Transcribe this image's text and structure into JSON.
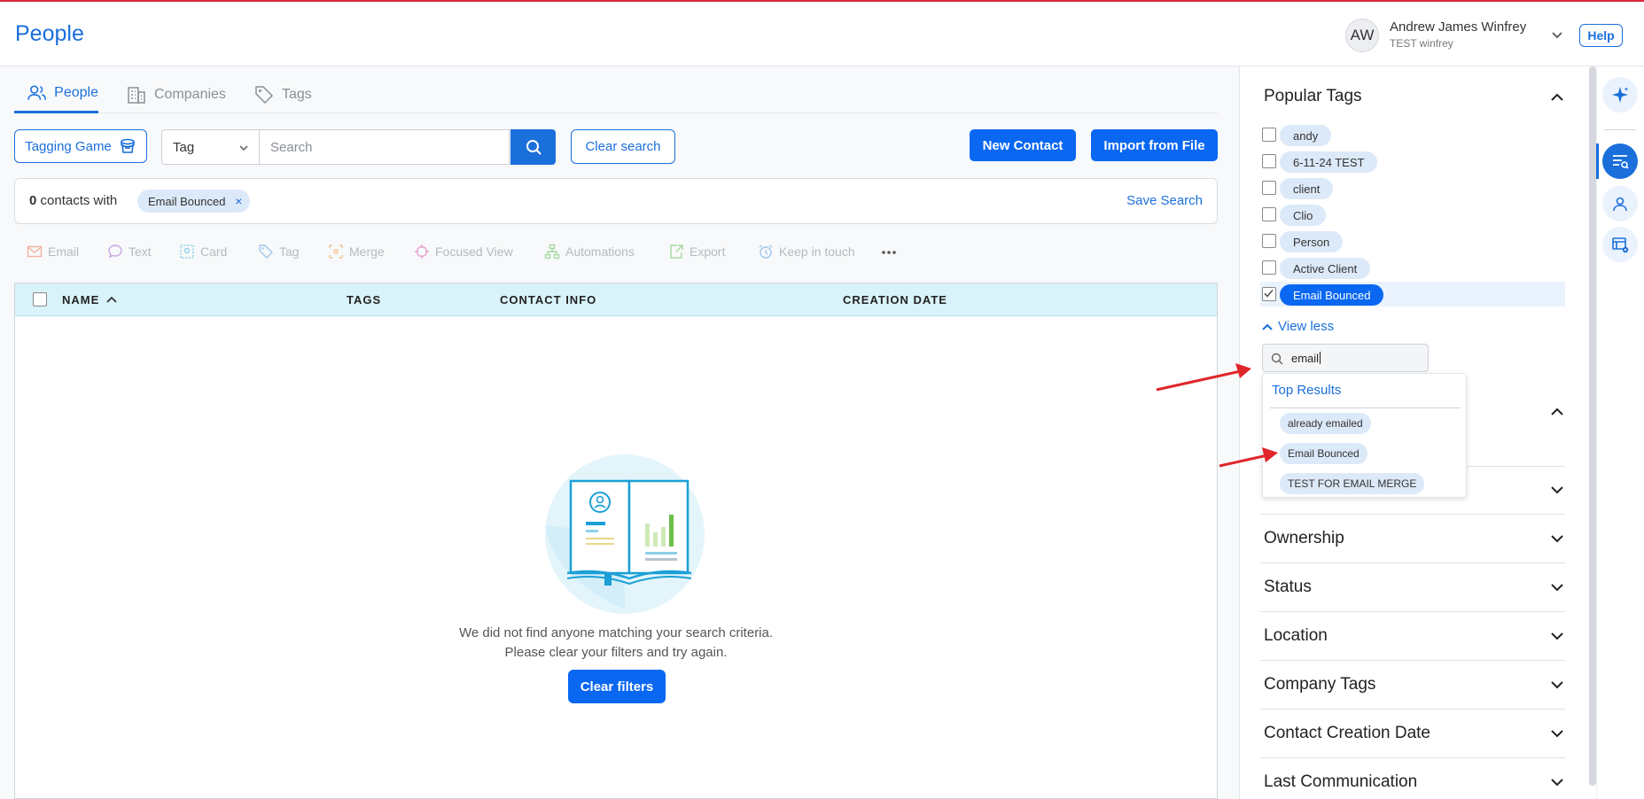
{
  "header": {
    "title": "People",
    "avatar_initials": "AW",
    "user_name": "Andrew James Winfrey",
    "user_org": "TEST winfrey",
    "help_label": "Help"
  },
  "tabs": [
    {
      "label": "People",
      "icon": "people-icon",
      "active": true
    },
    {
      "label": "Companies",
      "icon": "building-icon",
      "active": false
    },
    {
      "label": "Tags",
      "icon": "tag-icon",
      "active": false
    }
  ],
  "toolbar": {
    "tagging_game_label": "Tagging Game",
    "filter_type": "Tag",
    "search_placeholder": "Search",
    "clear_search_label": "Clear search",
    "new_contact_label": "New Contact",
    "import_label": "Import from File"
  },
  "filter_bar": {
    "count": "0",
    "count_suffix": "contacts with",
    "chip_label": "Email Bounced",
    "chip_remove": "×",
    "save_search_label": "Save Search"
  },
  "actions": [
    {
      "label": "Email",
      "icon": "mail-icon"
    },
    {
      "label": "Text",
      "icon": "chat-icon"
    },
    {
      "label": "Card",
      "icon": "card-icon"
    },
    {
      "label": "Tag",
      "icon": "tag-icon"
    },
    {
      "label": "Merge",
      "icon": "merge-icon"
    },
    {
      "label": "Focused View",
      "icon": "focus-icon"
    },
    {
      "label": "Automations",
      "icon": "automation-icon"
    },
    {
      "label": "Export",
      "icon": "export-icon"
    },
    {
      "label": "Keep in touch",
      "icon": "alarm-icon"
    }
  ],
  "table": {
    "columns": [
      "NAME",
      "TAGS",
      "CONTACT INFO",
      "CREATION DATE"
    ],
    "empty_line1": "We did not find anyone matching your search criteria.",
    "empty_line2": "Please clear your filters and try again.",
    "clear_filters_label": "Clear filters"
  },
  "sidebar": {
    "popular_tags_title": "Popular Tags",
    "tags": [
      {
        "label": "andy",
        "checked": false
      },
      {
        "label": "6-11-24 TEST",
        "checked": false
      },
      {
        "label": "client",
        "checked": false
      },
      {
        "label": "Clio",
        "checked": false
      },
      {
        "label": "Person",
        "checked": false
      },
      {
        "label": "Active Client",
        "checked": false
      },
      {
        "label": "Email Bounced",
        "checked": true
      }
    ],
    "view_less_label": "View less",
    "tag_search_value": "email",
    "dropdown": {
      "header": "Top Results",
      "results": [
        "already emailed",
        "Email Bounced",
        "TEST FOR EMAIL MERGE"
      ]
    },
    "sections": [
      "Ownership",
      "Status",
      "Location",
      "Company Tags",
      "Contact Creation Date",
      "Last Communication"
    ]
  },
  "colors": {
    "primary": "#0a67f2",
    "accent_text": "#1a6fdb",
    "table_header": "#d9f3fb",
    "annotation_arrow": "#e0262b"
  }
}
